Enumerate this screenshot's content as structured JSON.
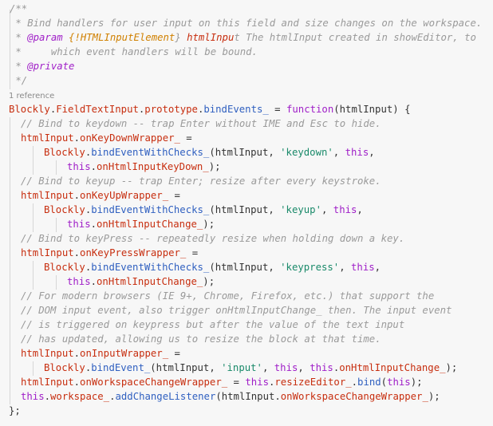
{
  "codelens": "1 reference",
  "doc_comment": [
    "/**",
    " * Bind handlers for user input on this field and size changes on the workspace.",
    " * @param {!HTMLInputElement} htmlInput The htmlInput created in showEditor, to",
    " *     which event handlers will be bound.",
    " * @private",
    " */"
  ],
  "code": [
    [
      [
        "id",
        "Blockly"
      ],
      [
        "pl",
        "."
      ],
      [
        "id",
        "FieldTextInput"
      ],
      [
        "pl",
        "."
      ],
      [
        "id",
        "prototype"
      ],
      [
        "pl",
        "."
      ],
      [
        "fn",
        "bindEvents_"
      ],
      [
        "pl",
        " = "
      ],
      [
        "kw",
        "function"
      ],
      [
        "pl",
        "(htmlInput) {"
      ]
    ],
    [
      [
        "cm",
        "// Bind to keydown -- trap Enter without IME and Esc to hide."
      ]
    ],
    [
      [
        "id",
        "htmlInput"
      ],
      [
        "pl",
        "."
      ],
      [
        "id",
        "onKeyDownWrapper_"
      ],
      [
        "pl",
        " ="
      ]
    ],
    [
      [
        "id",
        "Blockly"
      ],
      [
        "pl",
        "."
      ],
      [
        "fn",
        "bindEventWithChecks_"
      ],
      [
        "pl",
        "(htmlInput, "
      ],
      [
        "str",
        "'keydown'"
      ],
      [
        "pl",
        ", "
      ],
      [
        "kw",
        "this"
      ],
      [
        "pl",
        ","
      ]
    ],
    [
      [
        "kw",
        "this"
      ],
      [
        "pl",
        "."
      ],
      [
        "id",
        "onHtmlInputKeyDown_"
      ],
      [
        "pl",
        ");"
      ]
    ],
    [
      [
        "cm",
        "// Bind to keyup -- trap Enter; resize after every keystroke."
      ]
    ],
    [
      [
        "id",
        "htmlInput"
      ],
      [
        "pl",
        "."
      ],
      [
        "id",
        "onKeyUpWrapper_"
      ],
      [
        "pl",
        " ="
      ]
    ],
    [
      [
        "id",
        "Blockly"
      ],
      [
        "pl",
        "."
      ],
      [
        "fn",
        "bindEventWithChecks_"
      ],
      [
        "pl",
        "(htmlInput, "
      ],
      [
        "str",
        "'keyup'"
      ],
      [
        "pl",
        ", "
      ],
      [
        "kw",
        "this"
      ],
      [
        "pl",
        ","
      ]
    ],
    [
      [
        "kw",
        "this"
      ],
      [
        "pl",
        "."
      ],
      [
        "id",
        "onHtmlInputChange_"
      ],
      [
        "pl",
        ");"
      ]
    ],
    [
      [
        "cm",
        "// Bind to keyPress -- repeatedly resize when holding down a key."
      ]
    ],
    [
      [
        "id",
        "htmlInput"
      ],
      [
        "pl",
        "."
      ],
      [
        "id",
        "onKeyPressWrapper_"
      ],
      [
        "pl",
        " ="
      ]
    ],
    [
      [
        "id",
        "Blockly"
      ],
      [
        "pl",
        "."
      ],
      [
        "fn",
        "bindEventWithChecks_"
      ],
      [
        "pl",
        "(htmlInput, "
      ],
      [
        "str",
        "'keypress'"
      ],
      [
        "pl",
        ", "
      ],
      [
        "kw",
        "this"
      ],
      [
        "pl",
        ","
      ]
    ],
    [
      [
        "kw",
        "this"
      ],
      [
        "pl",
        "."
      ],
      [
        "id",
        "onHtmlInputChange_"
      ],
      [
        "pl",
        ");"
      ]
    ],
    [
      [
        "cm",
        "// For modern browsers (IE 9+, Chrome, Firefox, etc.) that support the"
      ]
    ],
    [
      [
        "cm",
        "// DOM input event, also trigger onHtmlInputChange_ then. The input event"
      ]
    ],
    [
      [
        "cm",
        "// is triggered on keypress but after the value of the text input"
      ]
    ],
    [
      [
        "cm",
        "// has updated, allowing us to resize the block at that time."
      ]
    ],
    [
      [
        "id",
        "htmlInput"
      ],
      [
        "pl",
        "."
      ],
      [
        "id",
        "onInputWrapper_"
      ],
      [
        "pl",
        " ="
      ]
    ],
    [
      [
        "id",
        "Blockly"
      ],
      [
        "pl",
        "."
      ],
      [
        "fn",
        "bindEvent_"
      ],
      [
        "pl",
        "(htmlInput, "
      ],
      [
        "str",
        "'input'"
      ],
      [
        "pl",
        ", "
      ],
      [
        "kw",
        "this"
      ],
      [
        "pl",
        ", "
      ],
      [
        "kw",
        "this"
      ],
      [
        "pl",
        "."
      ],
      [
        "id",
        "onHtmlInputChange_"
      ],
      [
        "pl",
        ");"
      ]
    ],
    [
      [
        "id",
        "htmlInput"
      ],
      [
        "pl",
        "."
      ],
      [
        "id",
        "onWorkspaceChangeWrapper_"
      ],
      [
        "pl",
        " = "
      ],
      [
        "kw",
        "this"
      ],
      [
        "pl",
        "."
      ],
      [
        "id",
        "resizeEditor_"
      ],
      [
        "pl",
        "."
      ],
      [
        "fn",
        "bind"
      ],
      [
        "pl",
        "("
      ],
      [
        "kw",
        "this"
      ],
      [
        "pl",
        ");"
      ]
    ],
    [
      [
        "kw",
        "this"
      ],
      [
        "pl",
        "."
      ],
      [
        "id",
        "workspace_"
      ],
      [
        "pl",
        "."
      ],
      [
        "fn",
        "addChangeListener"
      ],
      [
        "pl",
        "(htmlInput."
      ],
      [
        "id",
        "onWorkspaceChangeWrapper_"
      ],
      [
        "pl",
        ");"
      ]
    ],
    [
      [
        "pl",
        "};"
      ]
    ]
  ]
}
